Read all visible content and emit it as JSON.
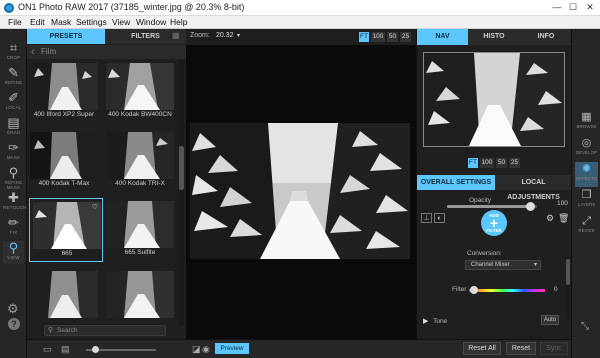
{
  "window": {
    "title": "ON1 Photo RAW 2017 (37185_winter.jpg @ 20.3% 8-bit)",
    "min_glyph": "—",
    "max_glyph": "☐",
    "close_glyph": "✕"
  },
  "menu": [
    "File",
    "Edit",
    "Mask",
    "Settings",
    "View",
    "Window",
    "Help"
  ],
  "tools": [
    {
      "label": "CROP",
      "icon": "crop-icon",
      "glyph": "⌗"
    },
    {
      "label": "REFINE",
      "icon": "refine-brush-icon",
      "glyph": "✎"
    },
    {
      "label": "LOCAL",
      "icon": "adjustment-brush-icon",
      "glyph": "✐"
    },
    {
      "label": "GRAD",
      "icon": "gradient-icon",
      "glyph": "▤"
    },
    {
      "label": "MASK",
      "icon": "masking-brush-icon",
      "glyph": "✑"
    },
    {
      "label": "REFINE MASK",
      "icon": "refine-mask-icon",
      "glyph": "⚲"
    },
    {
      "label": "RETOUCH",
      "icon": "retouch-icon",
      "glyph": "✚"
    },
    {
      "label": "FIX",
      "icon": "perfect-eraser-icon",
      "glyph": "✏"
    },
    {
      "label": "VIEW",
      "icon": "view-zoom-icon",
      "glyph": "⚲"
    }
  ],
  "browser": {
    "tabs": {
      "presets": "PRESETS",
      "filters": "FILTERS"
    },
    "breadcrumb": "Film",
    "search_placeholder": "Search",
    "presets": [
      {
        "name": "400 Ilford XP2 Super",
        "selected": false
      },
      {
        "name": "400 Kodak BW400CN",
        "selected": false
      },
      {
        "name": "400 Kodak T-Max",
        "selected": false
      },
      {
        "name": "400 Kodak TRI-X",
        "selected": false
      },
      {
        "name": "665",
        "selected": true
      },
      {
        "name": "665 Sulfite",
        "selected": false
      },
      {
        "name": "",
        "selected": false
      },
      {
        "name": "",
        "selected": false
      }
    ]
  },
  "canvas": {
    "zoom_label": "Zoom:",
    "zoom_value": "20.32",
    "zoom_buttons": [
      {
        "label": "FT",
        "active": true
      },
      {
        "label": "100",
        "active": false
      },
      {
        "label": "50",
        "active": false
      },
      {
        "label": "25",
        "active": false
      }
    ]
  },
  "right_panel": {
    "tabs": {
      "nav": "NAV",
      "histo": "HISTO",
      "info": "INFO"
    },
    "nav_zoom_buttons": [
      {
        "label": "FT",
        "active": true
      },
      {
        "label": "100",
        "active": false
      },
      {
        "label": "50",
        "active": false
      },
      {
        "label": "25",
        "active": false
      }
    ],
    "subtabs": {
      "overall": "OVERALL SETTINGS",
      "local": "LOCAL ADJUSTMENTS"
    },
    "opacity": {
      "label": "Opacity",
      "value": "100",
      "level": 0.92
    },
    "add_filter": {
      "top": "ADD",
      "plus": "+",
      "bottom": "FILTER"
    },
    "conversion": {
      "label": "Conversion:",
      "value": "Channel Mixer"
    },
    "filter": {
      "label": "Filter",
      "value": "0",
      "level": 0.07
    },
    "tone": {
      "label": "Tone",
      "auto": "Auto"
    }
  },
  "modules": [
    {
      "label": "BROWSE",
      "icon": "browse-icon",
      "glyph": "▦",
      "active": false
    },
    {
      "label": "DEVELOP",
      "icon": "develop-icon",
      "glyph": "◎",
      "active": false
    },
    {
      "label": "EFFECTS",
      "icon": "effects-icon",
      "glyph": "✺",
      "active": true
    },
    {
      "label": "LAYERS",
      "icon": "layers-icon",
      "glyph": "❒",
      "active": false
    },
    {
      "label": "RESIZE",
      "icon": "resize-icon",
      "glyph": "⤢",
      "active": false
    }
  ],
  "bottom": {
    "preview": "Preview",
    "reset_all": "Reset All",
    "reset": "Reset",
    "sync": "Sync"
  },
  "colors": {
    "accent": "#5cc6ff",
    "panel": "#1f1f1f",
    "canvas": "#0a0a0a"
  }
}
